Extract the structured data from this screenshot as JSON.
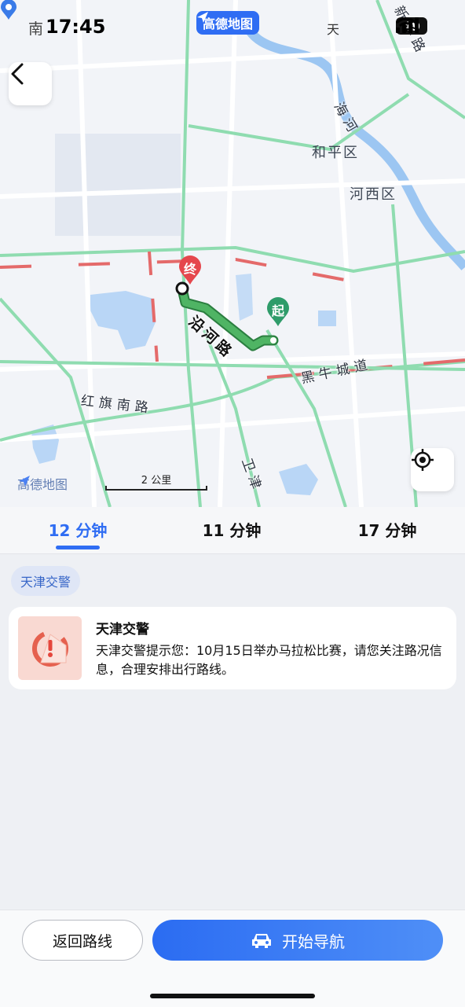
{
  "status_bar": {
    "prefix": "南",
    "time": "17:45",
    "app_badge": "高德地图",
    "place": "天",
    "battery": "49"
  },
  "map": {
    "district_labels": [
      "和平区",
      "河西区"
    ],
    "road_labels": {
      "route_road": "沿河路",
      "heiniu": "黑牛城道",
      "hongqi": "红旗南路",
      "weijin": "卫津",
      "haihe": "海河",
      "side_road": "新华路"
    },
    "start_pin": "起",
    "end_pin": "终",
    "watermark": "高德地图",
    "scale_text": "2 公里",
    "colors": {
      "route": "#3aa25a",
      "traffic_green": "#8fdcb0",
      "traffic_red": "#e46a6a",
      "river": "#9cc6f2"
    }
  },
  "tabs": [
    {
      "label": "12 分钟",
      "active": true
    },
    {
      "label": "11 分钟",
      "active": false
    },
    {
      "label": "17 分钟",
      "active": false
    }
  ],
  "notice": {
    "chip": "天津交警",
    "title": "天津交警",
    "body": "天津交警提示您：10月15日举办马拉松比赛，请您关注路况信息，合理安排出行路线。"
  },
  "actions": {
    "back_route": "返回路线",
    "start_nav": "开始导航"
  },
  "icons": [
    "location-arrow-icon",
    "signal-icon",
    "wifi-icon",
    "back-arrow-icon",
    "locate-icon",
    "warning-icon",
    "car-icon"
  ]
}
